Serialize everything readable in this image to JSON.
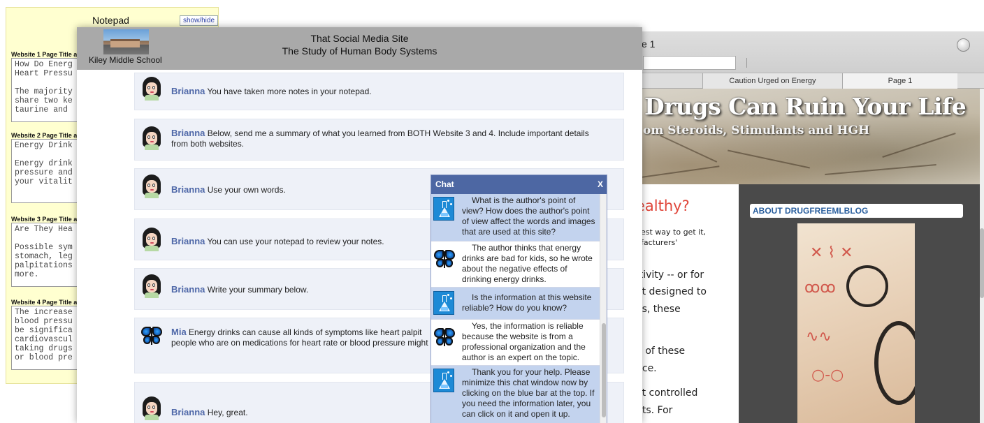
{
  "notepad": {
    "title": "Notepad",
    "toggle_label": "show/hide",
    "entries": [
      {
        "label": "Website 1 Page Title a",
        "text": "How Do Energ\nHeart Pressu\n\nThe majority\nshare two ke\ntaurine and"
      },
      {
        "label": "Website 2 Page Title a",
        "text": "Energy Drink\n\nEnergy drink\npressure and\nyour vitalit"
      },
      {
        "label": "Website 3 Page Title a",
        "text": "Are They Hea\n\nPossible sym\nstomach, leg\npalpitations\nmore."
      },
      {
        "label": "Website 4 Page Title a",
        "text": "The increase\nblood pressu\nbe significa\ncardiovascul\ntaking drugs\nor blood pre"
      }
    ]
  },
  "browser": {
    "title": "e 1",
    "tabs": [
      "Caution Urged on Energy",
      "Page 1"
    ],
    "banner_title": "Drugs Can Ruin Your Life",
    "banner_subtitle": "om Steroids, Stimulants and HGH",
    "article_heading": "ealthy?",
    "article_lines_small": [
      "best way to get it,",
      "ufacturers'"
    ],
    "article_lines_large": [
      ":tivity -- or for",
      "ot designed to",
      "es, these",
      "n of these",
      "nce.",
      "ot controlled",
      "nts. For"
    ],
    "sidebar_heading": "ABOUT DRUGFREEMLBLOG"
  },
  "social": {
    "school_name": "Kiley Middle School",
    "site_title": "That Social Media Site",
    "site_subtitle": "The Study of Human Body Systems",
    "messages": [
      {
        "sender": "Brianna",
        "avatar": "girl-avatar",
        "text": "You have taken more notes in your notepad."
      },
      {
        "sender": "Brianna",
        "avatar": "girl-avatar",
        "text": "Below, send me a summary of what you learned from BOTH Website 3 and 4. Include important details",
        "text2": "from both websites."
      },
      {
        "sender": "Brianna",
        "avatar": "girl-avatar",
        "text": "Use your own words."
      },
      {
        "sender": "Brianna",
        "avatar": "girl-avatar",
        "text": "You can use your notepad to review your notes."
      },
      {
        "sender": "Brianna",
        "avatar": "girl-avatar",
        "text": "Write your summary below."
      },
      {
        "sender": "Mia",
        "avatar": "butterfly-avatar",
        "text": "Energy drinks can cause all kinds of symptoms like heart palpit",
        "text2": "people who are on medications for heart rate or blood pressure might"
      },
      {
        "sender": "Brianna",
        "avatar": "girl-avatar",
        "text": "Hey, great."
      }
    ]
  },
  "chat": {
    "title": "Chat",
    "close_label": "X",
    "messages": [
      {
        "kind": "question",
        "icon": "science-flask-icon",
        "lines": [
          "What is the author's point of",
          "view? How does the author's point",
          "of view affect the words and images",
          "that are used at this site?"
        ]
      },
      {
        "kind": "answer",
        "icon": "butterfly-icon",
        "lines": [
          "The author thinks that energy",
          "drinks are bad for kids, so he wrote",
          "about the negative effects of",
          "drinking energy drinks."
        ]
      },
      {
        "kind": "question",
        "icon": "science-flask-icon",
        "lines": [
          "Is the information at this website",
          "reliable? How do you know?"
        ]
      },
      {
        "kind": "answer",
        "icon": "butterfly-icon",
        "lines": [
          "Yes, the information is reliable",
          "because the website is from a",
          "professional organization and the",
          "author is an expert on the topic."
        ]
      },
      {
        "kind": "question",
        "icon": "science-flask-icon",
        "lines": [
          "Thank you for your help. Please",
          "minimize this chat window now by",
          "clicking on the blue bar at the top. If",
          "you need the information later, you",
          "can click on it and open it up."
        ]
      }
    ]
  },
  "colors": {
    "notepad_bg": "#ffffd0",
    "header_gray": "#a9a9a9",
    "chat_header": "#4d67a3",
    "chat_question_bg": "#c3d3ee",
    "name_blue": "#4f68a8",
    "heading_red": "#e0463a"
  }
}
